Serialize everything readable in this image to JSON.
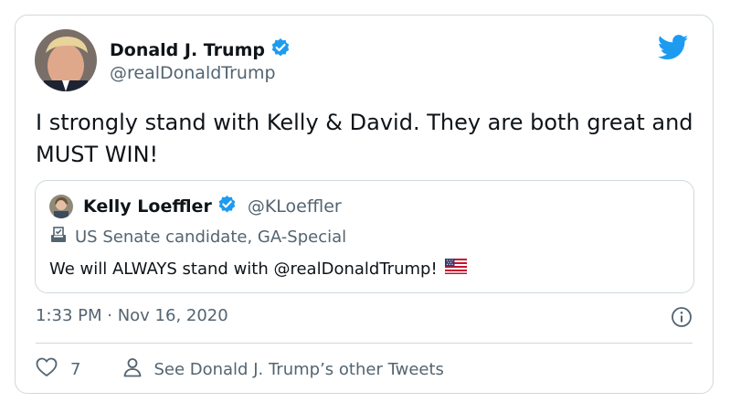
{
  "tweet": {
    "author_name": "Donald J. Trump",
    "author_handle": "@realDonaldTrump",
    "text": "I strongly stand with Kelly & David. They are both great and MUST WIN!",
    "timestamp": "1:33 PM · Nov 16, 2020"
  },
  "quoted_tweet": {
    "author_name": "Kelly Loeffler",
    "author_handle": "@KLoeffler",
    "label": "US Senate candidate, GA-Special",
    "text": "We will ALWAYS stand with @realDonaldTrump!"
  },
  "actions": {
    "like_count": "7",
    "other_tweets_label": "See Donald J. Trump’s other Tweets"
  },
  "icons": {
    "brand": "twitter-bird-icon",
    "verified": "verified-badge-icon",
    "label": "ballot-box-icon",
    "flag": "us-flag-icon",
    "info": "info-icon",
    "like": "heart-icon",
    "profile": "person-icon"
  },
  "colors": {
    "brand_blue": "#1d9bf0",
    "text_primary": "#0f1419",
    "text_secondary": "#536471",
    "border": "#cfd9de"
  }
}
